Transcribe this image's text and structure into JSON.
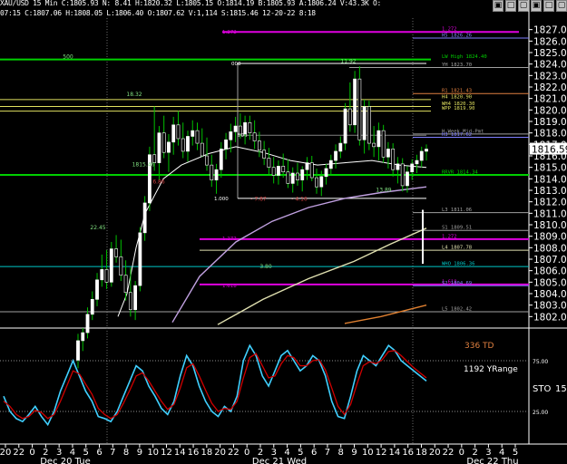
{
  "header": {
    "line1": "XAU/USD 15 Min C:1805.93 N: 8.41 H:1820.32 L:1805.15 O:1814.19 B:1805.93 A:1806.24 V:43.3K O:",
    "line2": "07:15 C:1807.06 H:1808.05 L:1806.40 O:1807.62 V:1,114 S:1815.46 12-20-22 8:18"
  },
  "window_buttons": [
    "▣",
    "□",
    "▢",
    "▣",
    "□",
    "▢"
  ],
  "colors": {
    "background": "#000000",
    "candle_body": "#ffffff",
    "candle_wick": "#00c000",
    "pivot_green": "#00d000",
    "pivot_magenta": "#e000e0",
    "pivot_yellow": "#e0e060",
    "pivot_cyan": "#00c8c8",
    "pivot_orange": "#e08040",
    "pivot_red": "#b00000",
    "stoch_k": "#40d0ff",
    "stoch_d": "#d00000",
    "ma_white": "#ffffff",
    "ma_lavender": "#c0a0e0",
    "ma_cream": "#e0e0b0",
    "ma_orange": "#e08030"
  },
  "chart_data": [
    {
      "type": "candlestick",
      "title": "XAU/USD 15 Min",
      "ylim": [
        1801.0,
        1828.0
      ],
      "y_ticks": [
        1802,
        1803,
        1804,
        1805,
        1806,
        1807,
        1808,
        1809,
        1810,
        1811,
        1812,
        1813,
        1814,
        1815,
        1816,
        1817,
        1818,
        1819,
        1820,
        1821,
        1822,
        1823,
        1824,
        1825,
        1826,
        1827
      ],
      "last_price": "1816.59",
      "candles": [
        [
          1798.2,
          1800.5,
          1797.5,
          1799.9
        ],
        [
          1799.9,
          1801.0,
          1799.0,
          1800.6
        ],
        [
          1800.6,
          1802.8,
          1800.1,
          1802.2
        ],
        [
          1802.2,
          1804.2,
          1801.7,
          1803.5
        ],
        [
          1803.5,
          1805.8,
          1802.9,
          1805.2
        ],
        [
          1805.2,
          1807.4,
          1804.6,
          1806.1
        ],
        [
          1806.1,
          1807.8,
          1804.4,
          1805.0
        ],
        [
          1805.0,
          1808.5,
          1804.6,
          1807.9
        ],
        [
          1807.9,
          1809.1,
          1806.7,
          1807.2
        ],
        [
          1807.2,
          1808.7,
          1805.1,
          1805.6
        ],
        [
          1805.6,
          1806.9,
          1803.4,
          1804.1
        ],
        [
          1804.1,
          1806.3,
          1802.0,
          1802.6
        ],
        [
          1802.6,
          1805.1,
          1801.7,
          1804.7
        ],
        [
          1804.7,
          1809.8,
          1804.2,
          1809.3
        ],
        [
          1809.3,
          1812.5,
          1808.6,
          1811.9
        ],
        [
          1811.9,
          1816.8,
          1811.2,
          1816.1
        ],
        [
          1816.1,
          1820.3,
          1814.7,
          1815.4
        ],
        [
          1815.4,
          1818.6,
          1813.9,
          1818.0
        ],
        [
          1818.0,
          1819.5,
          1815.8,
          1816.3
        ],
        [
          1816.3,
          1817.9,
          1814.6,
          1817.2
        ],
        [
          1817.2,
          1819.4,
          1816.1,
          1818.7
        ],
        [
          1818.7,
          1819.9,
          1816.9,
          1817.5
        ],
        [
          1817.5,
          1818.9,
          1815.8,
          1816.4
        ],
        [
          1816.4,
          1818.2,
          1815.5,
          1817.7
        ],
        [
          1817.7,
          1819.1,
          1816.9,
          1818.2
        ],
        [
          1818.2,
          1818.9,
          1816.5,
          1817.1
        ],
        [
          1817.1,
          1818.4,
          1815.9,
          1816.0
        ],
        [
          1816.0,
          1817.6,
          1814.7,
          1815.2
        ],
        [
          1815.2,
          1816.1,
          1813.3,
          1813.9
        ],
        [
          1813.9,
          1815.3,
          1812.7,
          1814.8
        ],
        [
          1814.8,
          1817.2,
          1814.1,
          1816.6
        ],
        [
          1816.6,
          1818.0,
          1815.7,
          1817.4
        ],
        [
          1817.4,
          1818.8,
          1816.3,
          1818.1
        ],
        [
          1818.1,
          1819.4,
          1817.2,
          1818.6
        ],
        [
          1818.6,
          1819.7,
          1817.5,
          1817.9
        ],
        [
          1817.9,
          1819.5,
          1817.0,
          1818.9
        ],
        [
          1818.9,
          1819.5,
          1817.4,
          1818.0
        ],
        [
          1818.0,
          1819.1,
          1816.6,
          1817.3
        ],
        [
          1817.3,
          1818.1,
          1815.9,
          1816.5
        ],
        [
          1816.5,
          1817.3,
          1815.2,
          1815.8
        ],
        [
          1815.8,
          1816.7,
          1814.4,
          1815.0
        ],
        [
          1815.0,
          1815.9,
          1813.6,
          1814.3
        ],
        [
          1814.3,
          1815.6,
          1813.5,
          1815.1
        ],
        [
          1815.1,
          1816.2,
          1814.1,
          1814.6
        ],
        [
          1814.6,
          1815.7,
          1813.2,
          1813.6
        ],
        [
          1813.6,
          1815.0,
          1812.8,
          1814.5
        ],
        [
          1814.5,
          1815.4,
          1813.4,
          1813.9
        ],
        [
          1813.9,
          1815.1,
          1812.9,
          1814.8
        ],
        [
          1814.8,
          1815.9,
          1813.9,
          1815.4
        ],
        [
          1815.4,
          1816.0,
          1813.8,
          1814.1
        ],
        [
          1814.1,
          1814.9,
          1812.7,
          1813.3
        ],
        [
          1813.3,
          1814.7,
          1812.5,
          1814.2
        ],
        [
          1814.2,
          1815.3,
          1813.5,
          1814.9
        ],
        [
          1814.9,
          1816.1,
          1814.3,
          1815.6
        ],
        [
          1815.6,
          1817.0,
          1814.9,
          1816.4
        ],
        [
          1816.4,
          1817.7,
          1815.8,
          1817.1
        ],
        [
          1817.1,
          1820.6,
          1816.5,
          1820.1
        ],
        [
          1820.1,
          1822.4,
          1818.1,
          1818.7
        ],
        [
          1818.7,
          1823.4,
          1818.0,
          1822.7
        ],
        [
          1822.7,
          1823.8,
          1816.9,
          1817.4
        ],
        [
          1817.4,
          1820.9,
          1816.2,
          1820.3
        ],
        [
          1820.3,
          1820.8,
          1816.5,
          1817.1
        ],
        [
          1817.1,
          1818.6,
          1815.9,
          1816.8
        ],
        [
          1816.8,
          1818.9,
          1815.6,
          1818.2
        ],
        [
          1818.2,
          1818.7,
          1815.4,
          1815.9
        ],
        [
          1815.9,
          1817.2,
          1814.9,
          1816.6
        ],
        [
          1816.6,
          1817.1,
          1814.2,
          1814.8
        ],
        [
          1814.8,
          1815.9,
          1813.6,
          1815.3
        ],
        [
          1815.3,
          1815.8,
          1812.9,
          1813.4
        ],
        [
          1813.4,
          1815.1,
          1812.8,
          1814.6
        ],
        [
          1814.6,
          1815.7,
          1813.9,
          1815.3
        ],
        [
          1815.3,
          1816.1,
          1814.5,
          1815.6
        ],
        [
          1815.6,
          1816.8,
          1815.0,
          1816.4
        ],
        [
          1816.4,
          1817.0,
          1815.6,
          1816.59
        ]
      ],
      "candles_ohlc_order": [
        "open",
        "high",
        "low",
        "close"
      ],
      "levels": [
        {
          "label": "1.272",
          "value": 1826.8,
          "color": "#e000e0"
        },
        {
          "label": "H5 1826.26",
          "value": 1826.26,
          "color": "#8080ff"
        },
        {
          "label": "LW High 1824.40",
          "value": 1824.4,
          "color": "#00d000"
        },
        {
          "label": "YH 1823.70",
          "value": 1823.7,
          "color": "#a0a0a0"
        },
        {
          "label": "R1 1821.43",
          "value": 1821.43,
          "color": "#e08040"
        },
        {
          "label": "H4 1820.90",
          "value": 1820.9,
          "color": "#e0e060"
        },
        {
          "label": "WH4 1820.30",
          "value": 1820.3,
          "color": "#e0e060"
        },
        {
          "label": "WPP 1819.90",
          "value": 1819.9,
          "color": "#e0e060"
        },
        {
          "label": "H-Week Mid-Pmt",
          "value": 1817.9,
          "color": "#a0a0a0"
        },
        {
          "label": "H3 1817.62",
          "value": 1817.62,
          "color": "#8080ff"
        },
        {
          "label": "RRVR 1814.34",
          "value": 1814.34,
          "color": "#00d000"
        },
        {
          "label": "L3 1811.06",
          "value": 1811.06,
          "color": "#a0a0a0"
        },
        {
          "label": "S1 1809.51",
          "value": 1809.51,
          "color": "#a0a0a0"
        },
        {
          "label": "1.272",
          "value": 1808.75,
          "color": "#e000e0"
        },
        {
          "label": "L4 1807.78",
          "value": 1807.78,
          "color": "#e0e0b0"
        },
        {
          "label": "WHO 1806.36",
          "value": 1806.36,
          "color": "#00c8c8"
        },
        {
          "label": "1.618",
          "value": 1804.8,
          "color": "#e000e0"
        },
        {
          "label": "S2 1804.69",
          "value": 1804.69,
          "color": "#8080ff"
        },
        {
          "label": "L5 1802.42",
          "value": 1802.42,
          "color": "#a0a0a0"
        }
      ],
      "fib_labels": [
        {
          "text": "1.272",
          "value": 1826.8
        },
        {
          "text": "000",
          "value": 1824.05
        },
        {
          "text": "500",
          "value": 1817.8
        },
        {
          "text": "1.000",
          "value": 1812.3
        },
        {
          "text": "1.272",
          "value": 1808.8
        },
        {
          "text": "1.618",
          "value": 1804.7
        }
      ],
      "annotations": [
        {
          "text": "18.32",
          "value": 1821.2
        },
        {
          "text": "11.92",
          "value": 1824.1
        },
        {
          "text": "1815.46",
          "value": 1815.1
        },
        {
          "text": "22.45",
          "value": 1809.6
        },
        {
          "text": "6.86",
          "value": 1813.6
        },
        {
          "text": "- 7.87",
          "value": 1812.1
        },
        {
          "text": "- 4.16",
          "value": 1812.1
        },
        {
          "text": "13.89",
          "value": 1812.9
        },
        {
          "text": "3.80",
          "value": 1806.2
        },
        {
          "text": "500",
          "value": 1824.5
        }
      ]
    },
    {
      "type": "line",
      "title": "STO",
      "series": [
        {
          "name": "336 TD",
          "values": [
            40,
            25,
            18,
            15,
            22,
            30,
            20,
            12,
            25,
            45,
            60,
            75,
            60,
            45,
            35,
            20,
            18,
            15,
            25,
            40,
            55,
            70,
            65,
            50,
            40,
            28,
            22,
            35,
            60,
            80,
            70,
            50,
            35,
            25,
            20,
            30,
            25,
            40,
            75,
            90,
            80,
            60,
            50,
            65,
            80,
            85,
            75,
            65,
            70,
            80,
            75,
            60,
            35,
            20,
            18,
            40,
            65,
            80,
            75,
            70,
            80,
            90,
            85,
            75,
            70,
            65,
            60,
            55
          ]
        },
        {
          "name": "1192 YRange",
          "values": [
            35,
            30,
            22,
            18,
            20,
            26,
            24,
            18,
            22,
            35,
            50,
            65,
            62,
            52,
            42,
            28,
            22,
            18,
            22,
            33,
            46,
            60,
            63,
            55,
            45,
            35,
            27,
            32,
            48,
            68,
            72,
            60,
            46,
            33,
            25,
            28,
            27,
            35,
            58,
            78,
            82,
            70,
            58,
            60,
            72,
            80,
            78,
            70,
            70,
            75,
            76,
            66,
            48,
            30,
            22,
            32,
            52,
            70,
            74,
            72,
            76,
            84,
            85,
            80,
            74,
            68,
            63,
            58
          ]
        }
      ],
      "levels": [
        {
          "label": "25.00",
          "value": 25
        },
        {
          "label": "75.00",
          "value": 75
        }
      ],
      "ylim": [
        0,
        100
      ],
      "indicator_labels": {
        "td": "336 TD",
        "yrange": "1192 YRange",
        "sto": "STO",
        "sto_value": "15,"
      }
    }
  ],
  "x_axis": {
    "ticks": [
      "20",
      "22",
      "0",
      "2",
      "3",
      "4",
      "5",
      "6",
      "7",
      "8",
      "9",
      "10",
      "12",
      "14",
      "16",
      "18",
      "20",
      "22",
      "0",
      "2",
      "3",
      "4",
      "5",
      "6",
      "7",
      "8",
      "9",
      "10",
      "12",
      "14",
      "16",
      "18",
      "20",
      "22",
      "0",
      "2",
      "3",
      "4",
      "5"
    ],
    "dates": [
      "Dec 20 Tue",
      "Dec 21 Wed",
      "Dec 22 Thu"
    ]
  }
}
